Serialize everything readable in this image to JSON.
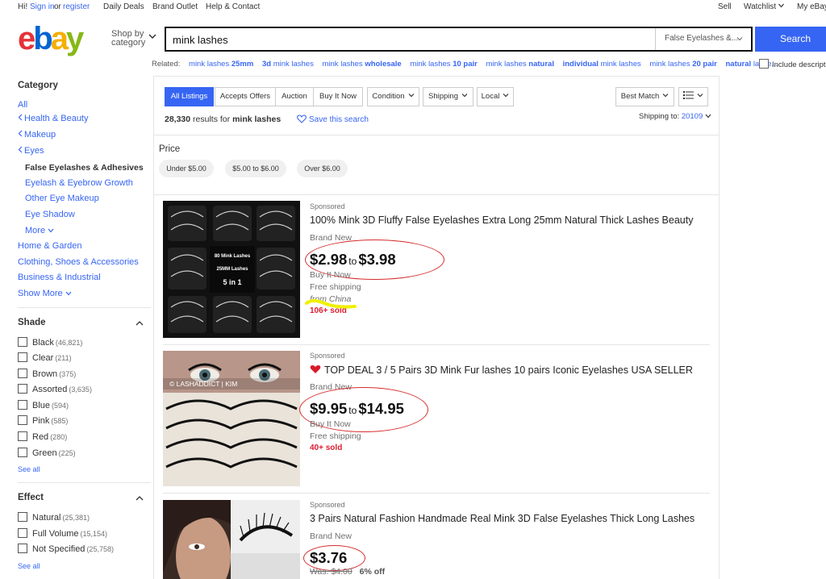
{
  "topbar": {
    "greet": "Hi!",
    "signin": "Sign in",
    "or": "or",
    "register": "register",
    "daily_deals": "Daily Deals",
    "brand_outlet": "Brand Outlet",
    "help": "Help & Contact",
    "sell": "Sell",
    "watchlist": "Watchlist",
    "myebay": "My eBay"
  },
  "header": {
    "logo": [
      "e",
      "b",
      "a",
      "y"
    ],
    "shop_by_line1": "Shop by",
    "shop_by_line2": "category",
    "search_value": "mink lashes",
    "category_select": "False Eyelashes &...",
    "search_button": "Search"
  },
  "related": {
    "label": "Related:",
    "items": [
      {
        "plain": "mink lashes ",
        "bold": "25mm"
      },
      {
        "plain": "3d ",
        "bold": "",
        "rest": "mink lashes"
      },
      {
        "plain": "mink lashes ",
        "bold": "wholesale"
      },
      {
        "plain": "mink lashes ",
        "bold": "10 pair"
      },
      {
        "plain": "mink lashes ",
        "bold": "natural"
      },
      {
        "plain": "individual ",
        "bold": "",
        "rest": "mink lashes"
      },
      {
        "plain": "mink lashes ",
        "bold": "20 pair"
      },
      {
        "plain": "natural ",
        "bold": "",
        "rest": "lashe..."
      }
    ],
    "include_desc": "Include descripti"
  },
  "sidebar": {
    "category_heading": "Category",
    "all": "All",
    "health_beauty": "Health & Beauty",
    "makeup": "Makeup",
    "eyes": "Eyes",
    "current": "False Eyelashes & Adhesives",
    "eyelash_growth": "Eyelash & Eyebrow Growth",
    "other_eye": "Other Eye Makeup",
    "eye_shadow": "Eye Shadow",
    "more": "More",
    "home_garden": "Home & Garden",
    "clothing": "Clothing, Shoes & Accessories",
    "business": "Business & Industrial",
    "show_more": "Show More",
    "shade_heading": "Shade",
    "shades": [
      {
        "label": "Black",
        "count": "(46,821)"
      },
      {
        "label": "Clear",
        "count": "(211)"
      },
      {
        "label": "Brown",
        "count": "(375)"
      },
      {
        "label": "Assorted",
        "count": "(3,635)"
      },
      {
        "label": "Blue",
        "count": "(594)"
      },
      {
        "label": "Pink",
        "count": "(585)"
      },
      {
        "label": "Red",
        "count": "(280)"
      },
      {
        "label": "Green",
        "count": "(225)"
      }
    ],
    "see_all": "See all",
    "effect_heading": "Effect",
    "effects": [
      {
        "label": "Natural",
        "count": "(25,381)"
      },
      {
        "label": "Full Volume",
        "count": "(15,154)"
      },
      {
        "label": "Not Specified",
        "count": "(25,758)"
      }
    ],
    "see_all_2": "See all"
  },
  "toolbar": {
    "all_listings": "All Listings",
    "accepts_offers": "Accepts Offers",
    "auction": "Auction",
    "buy_it_now": "Buy It Now",
    "condition": "Condition",
    "shipping": "Shipping",
    "local": "Local",
    "sort": "Best Match",
    "results_count": "28,330",
    "results_for": "results for",
    "query": "mink lashes",
    "save_search": "Save this search",
    "shipping_to_label": "Shipping to:",
    "zip": "20109"
  },
  "price_filter": {
    "heading": "Price",
    "chips": [
      "Under $5.00",
      "$5.00 to $6.00",
      "Over $6.00"
    ]
  },
  "listings": [
    {
      "sponsored": "Sponsored",
      "title": "100% Mink 3D Fluffy False Eyelashes Extra Long 25mm Natural Thick Lashes Beauty",
      "condition": "Brand New",
      "price_low": "$2.98",
      "price_to": "to",
      "price_high": "$3.98",
      "buy": "Buy It Now",
      "shipping": "Free shipping",
      "origin": "from China",
      "sold": "106+ sold",
      "thumb_text": [
        "80 Mink Lashes",
        "25MM Lashes",
        "5 in 1"
      ]
    },
    {
      "sponsored": "Sponsored",
      "title": "TOP DEAL 3 / 5 Pairs 3D Mink Fur lashes 10 pairs Iconic Eyelashes USA SELLER",
      "condition": "Brand New",
      "price_low": "$9.95",
      "price_to": "to",
      "price_high": "$14.95",
      "buy": "Buy It Now",
      "shipping": "Free shipping",
      "sold": "40+ sold",
      "thumb_text": "© LASHADDICT | KIM"
    },
    {
      "sponsored": "Sponsored",
      "title": "3 Pairs Natural Fashion Handmade Real Mink 3D False Eyelashes Thick Long Lashes",
      "condition": "Brand New",
      "price": "$3.76",
      "was": "Was: $4.00",
      "discount": "6% off"
    }
  ],
  "colors": {
    "link": "#3665f3",
    "search_btn": "#3665f3",
    "sold": "#dd1e31",
    "annotation_oval": "#d62b2b",
    "highlight": "#f0f000"
  }
}
